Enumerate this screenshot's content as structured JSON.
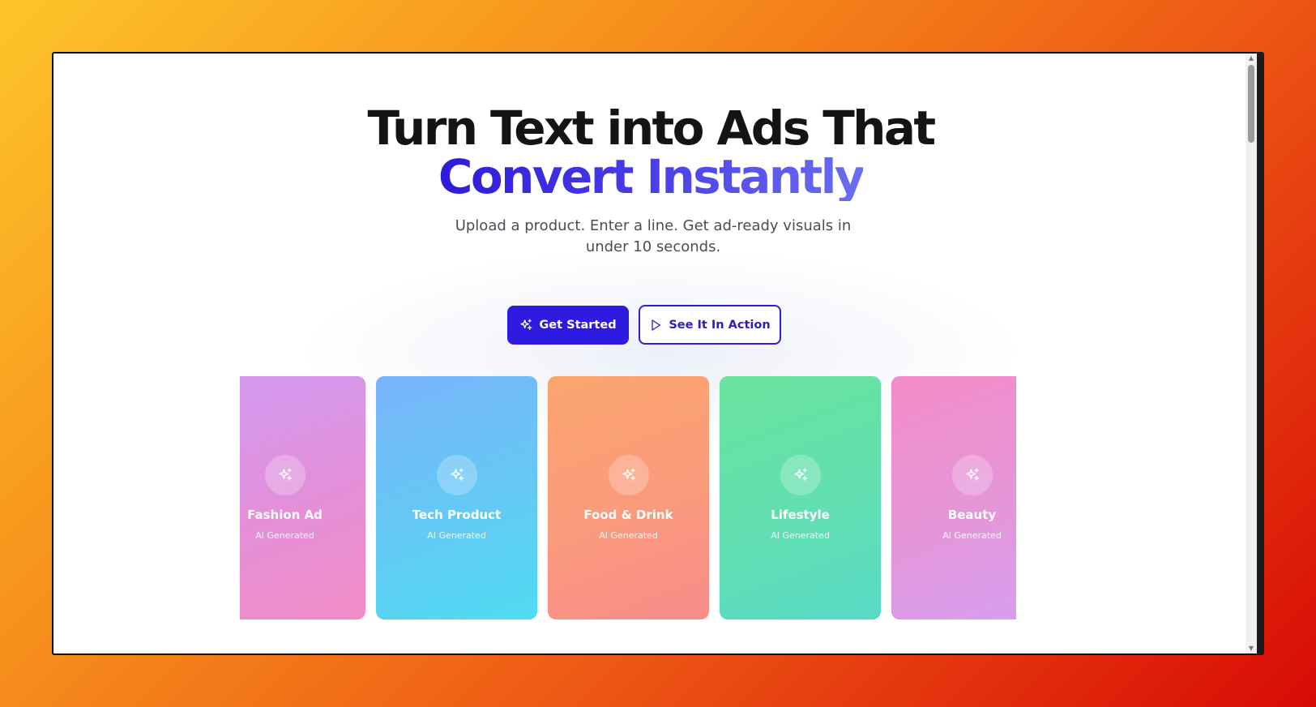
{
  "hero": {
    "headline_line1": "Turn Text into Ads That",
    "headline_line2": "Convert Instantly",
    "subtitle": "Upload a product. Enter a line. Get ad-ready visuals in under 10 seconds."
  },
  "buttons": {
    "get_started": {
      "label": "Get Started",
      "icon": "sparkles-icon"
    },
    "see_in_action": {
      "label": "See It In Action",
      "icon": "play-icon"
    }
  },
  "cards": [
    {
      "title": "Fashion Ad",
      "subtitle": "AI Generated",
      "icon": "sparkles-icon"
    },
    {
      "title": "Tech Product",
      "subtitle": "AI Generated",
      "icon": "sparkles-icon"
    },
    {
      "title": "Food & Drink",
      "subtitle": "AI Generated",
      "icon": "sparkles-icon"
    },
    {
      "title": "Lifestyle",
      "subtitle": "AI Generated",
      "icon": "sparkles-icon"
    },
    {
      "title": "Beauty",
      "subtitle": "AI Generated",
      "icon": "sparkles-icon"
    }
  ],
  "colors": {
    "primary": "#2e1be0",
    "headline": "#141414",
    "subtitle": "#4a4d55"
  }
}
